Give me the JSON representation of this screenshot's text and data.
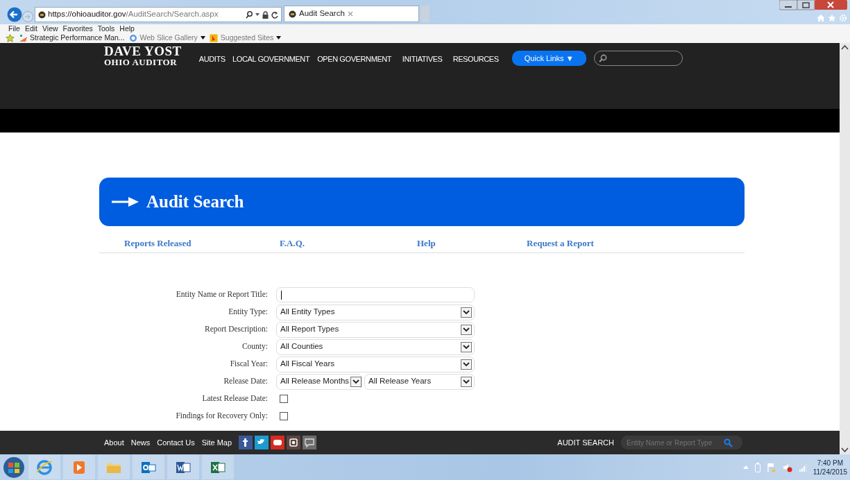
{
  "browser": {
    "url_host": "https://ohioauditor.gov",
    "url_path": "/AuditSearch/Search.aspx",
    "tab_title": "Audit Search",
    "menu": [
      "File",
      "Edit",
      "View",
      "Favorites",
      "Tools",
      "Help"
    ],
    "favorites": [
      {
        "label": "Strategic Performance Man...",
        "dropdown": false
      },
      {
        "label": "Web Slice Gallery",
        "dropdown": true
      },
      {
        "label": "Suggested Sites",
        "dropdown": true
      }
    ]
  },
  "site_header": {
    "logo_name": "DAVE YOST",
    "logo_subtitle": "OHIO AUDITOR",
    "nav": [
      "AUDITS",
      "LOCAL GOVERNMENT",
      "OPEN GOVERNMENT",
      "INITIATIVES",
      "RESOURCES"
    ],
    "quick_links": "Quick Links",
    "quick_links_caret": "▼"
  },
  "page": {
    "title": "Audit Search",
    "links": [
      "Reports Released",
      "F.A.Q.",
      "Help",
      "Request a Report"
    ],
    "form": [
      {
        "kind": "text",
        "label": "Entity Name or Report Title:",
        "focused": true
      },
      {
        "kind": "select",
        "label": "Entity Type:",
        "values": [
          "All Entity Types"
        ]
      },
      {
        "kind": "select",
        "label": "Report Description:",
        "values": [
          "All Report Types"
        ]
      },
      {
        "kind": "select",
        "label": "County:",
        "values": [
          "All Counties"
        ]
      },
      {
        "kind": "select",
        "label": "Fiscal Year:",
        "values": [
          "All Fiscal Years"
        ]
      },
      {
        "kind": "select",
        "label": "Release Date:",
        "values": [
          "All Release Months",
          "All Release Years"
        ]
      },
      {
        "kind": "checkbox",
        "label": "Latest Release Date:",
        "checked": false
      },
      {
        "kind": "checkbox",
        "label": "Findings for Recovery Only:",
        "checked": false
      }
    ]
  },
  "footer": {
    "links": [
      "About",
      "News",
      "Contact Us",
      "Site Map"
    ],
    "search_label": "AUDIT SEARCH",
    "search_placeholder": "Entity Name or Report Type"
  },
  "taskbar": {
    "time": "7:40 PM",
    "date": "11/24/2015"
  }
}
